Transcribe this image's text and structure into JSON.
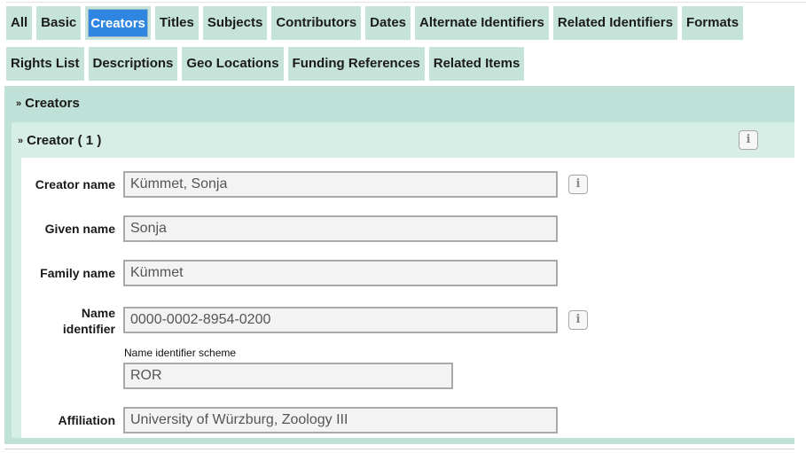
{
  "tabs_row1": [
    "All",
    "Basic",
    "Creators",
    "Titles",
    "Subjects",
    "Contributors",
    "Dates",
    "Alternate Identifiers",
    "Related Identifiers",
    "Formats"
  ],
  "tabs_row2": [
    "Rights List",
    "Descriptions",
    "Geo Locations",
    "Funding References",
    "Related Items"
  ],
  "active_tab": "Creators",
  "section": {
    "title": "Creators",
    "icon": "double-chevron-down-icon"
  },
  "creator": {
    "title": "Creator ( 1 )",
    "info_glyph": "i",
    "fields": {
      "creator_name": {
        "label": "Creator name",
        "value": "Kümmet, Sonja"
      },
      "given_name": {
        "label": "Given name",
        "value": "Sonja"
      },
      "family_name": {
        "label": "Family name",
        "value": "Kümmet"
      },
      "name_identifier": {
        "label_line1": "Name",
        "label_line2": "identifier",
        "value": "0000-0002-8954-0200"
      },
      "name_identifier_scheme": {
        "label": "Name identifier scheme",
        "value": "ROR"
      },
      "affiliation": {
        "label": "Affiliation",
        "value": "University of Würzburg, Zoology III"
      }
    }
  },
  "colors": {
    "tab_bg": "#c6e3d9",
    "active_tab_bg": "#2e86e0",
    "panel_bg": "#bfe1d7",
    "inner_bg": "#d7eee6"
  }
}
